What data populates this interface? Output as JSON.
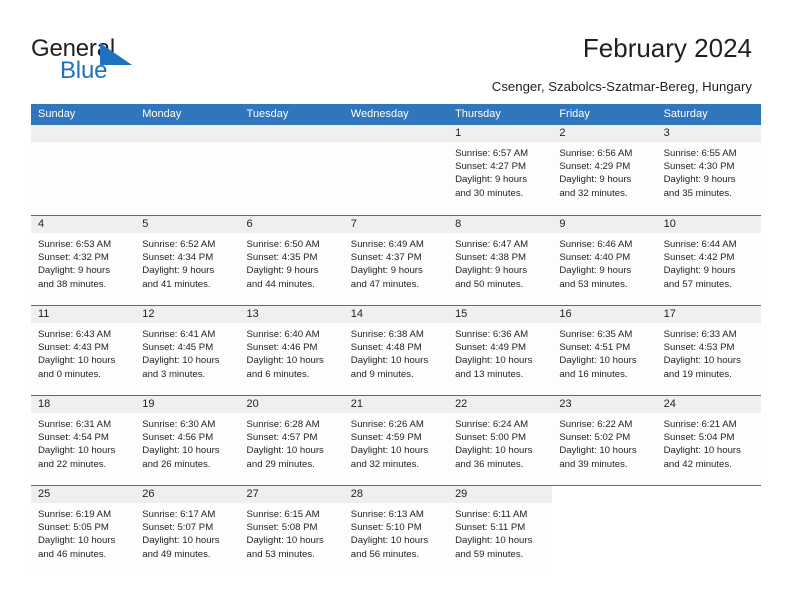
{
  "brand": {
    "name_part1": "General",
    "name_part2": "Blue",
    "mark": "triangle-logo"
  },
  "header": {
    "title": "February 2024",
    "subtitle": "Csenger, Szabolcs-Szatmar-Bereg, Hungary"
  },
  "calendar": {
    "weekdays": [
      "Sunday",
      "Monday",
      "Tuesday",
      "Wednesday",
      "Thursday",
      "Friday",
      "Saturday"
    ],
    "accent_color": "#2f76bc",
    "daynum_bg": "#efefef",
    "weeks": [
      [
        {
          "day": "",
          "lines": []
        },
        {
          "day": "",
          "lines": []
        },
        {
          "day": "",
          "lines": []
        },
        {
          "day": "",
          "lines": []
        },
        {
          "day": "1",
          "lines": [
            "Sunrise: 6:57 AM",
            "Sunset: 4:27 PM",
            "Daylight: 9 hours",
            "and 30 minutes."
          ]
        },
        {
          "day": "2",
          "lines": [
            "Sunrise: 6:56 AM",
            "Sunset: 4:29 PM",
            "Daylight: 9 hours",
            "and 32 minutes."
          ]
        },
        {
          "day": "3",
          "lines": [
            "Sunrise: 6:55 AM",
            "Sunset: 4:30 PM",
            "Daylight: 9 hours",
            "and 35 minutes."
          ]
        }
      ],
      [
        {
          "day": "4",
          "lines": [
            "Sunrise: 6:53 AM",
            "Sunset: 4:32 PM",
            "Daylight: 9 hours",
            "and 38 minutes."
          ]
        },
        {
          "day": "5",
          "lines": [
            "Sunrise: 6:52 AM",
            "Sunset: 4:34 PM",
            "Daylight: 9 hours",
            "and 41 minutes."
          ]
        },
        {
          "day": "6",
          "lines": [
            "Sunrise: 6:50 AM",
            "Sunset: 4:35 PM",
            "Daylight: 9 hours",
            "and 44 minutes."
          ]
        },
        {
          "day": "7",
          "lines": [
            "Sunrise: 6:49 AM",
            "Sunset: 4:37 PM",
            "Daylight: 9 hours",
            "and 47 minutes."
          ]
        },
        {
          "day": "8",
          "lines": [
            "Sunrise: 6:47 AM",
            "Sunset: 4:38 PM",
            "Daylight: 9 hours",
            "and 50 minutes."
          ]
        },
        {
          "day": "9",
          "lines": [
            "Sunrise: 6:46 AM",
            "Sunset: 4:40 PM",
            "Daylight: 9 hours",
            "and 53 minutes."
          ]
        },
        {
          "day": "10",
          "lines": [
            "Sunrise: 6:44 AM",
            "Sunset: 4:42 PM",
            "Daylight: 9 hours",
            "and 57 minutes."
          ]
        }
      ],
      [
        {
          "day": "11",
          "lines": [
            "Sunrise: 6:43 AM",
            "Sunset: 4:43 PM",
            "Daylight: 10 hours",
            "and 0 minutes."
          ]
        },
        {
          "day": "12",
          "lines": [
            "Sunrise: 6:41 AM",
            "Sunset: 4:45 PM",
            "Daylight: 10 hours",
            "and 3 minutes."
          ]
        },
        {
          "day": "13",
          "lines": [
            "Sunrise: 6:40 AM",
            "Sunset: 4:46 PM",
            "Daylight: 10 hours",
            "and 6 minutes."
          ]
        },
        {
          "day": "14",
          "lines": [
            "Sunrise: 6:38 AM",
            "Sunset: 4:48 PM",
            "Daylight: 10 hours",
            "and 9 minutes."
          ]
        },
        {
          "day": "15",
          "lines": [
            "Sunrise: 6:36 AM",
            "Sunset: 4:49 PM",
            "Daylight: 10 hours",
            "and 13 minutes."
          ]
        },
        {
          "day": "16",
          "lines": [
            "Sunrise: 6:35 AM",
            "Sunset: 4:51 PM",
            "Daylight: 10 hours",
            "and 16 minutes."
          ]
        },
        {
          "day": "17",
          "lines": [
            "Sunrise: 6:33 AM",
            "Sunset: 4:53 PM",
            "Daylight: 10 hours",
            "and 19 minutes."
          ]
        }
      ],
      [
        {
          "day": "18",
          "lines": [
            "Sunrise: 6:31 AM",
            "Sunset: 4:54 PM",
            "Daylight: 10 hours",
            "and 22 minutes."
          ]
        },
        {
          "day": "19",
          "lines": [
            "Sunrise: 6:30 AM",
            "Sunset: 4:56 PM",
            "Daylight: 10 hours",
            "and 26 minutes."
          ]
        },
        {
          "day": "20",
          "lines": [
            "Sunrise: 6:28 AM",
            "Sunset: 4:57 PM",
            "Daylight: 10 hours",
            "and 29 minutes."
          ]
        },
        {
          "day": "21",
          "lines": [
            "Sunrise: 6:26 AM",
            "Sunset: 4:59 PM",
            "Daylight: 10 hours",
            "and 32 minutes."
          ]
        },
        {
          "day": "22",
          "lines": [
            "Sunrise: 6:24 AM",
            "Sunset: 5:00 PM",
            "Daylight: 10 hours",
            "and 36 minutes."
          ]
        },
        {
          "day": "23",
          "lines": [
            "Sunrise: 6:22 AM",
            "Sunset: 5:02 PM",
            "Daylight: 10 hours",
            "and 39 minutes."
          ]
        },
        {
          "day": "24",
          "lines": [
            "Sunrise: 6:21 AM",
            "Sunset: 5:04 PM",
            "Daylight: 10 hours",
            "and 42 minutes."
          ]
        }
      ],
      [
        {
          "day": "25",
          "lines": [
            "Sunrise: 6:19 AM",
            "Sunset: 5:05 PM",
            "Daylight: 10 hours",
            "and 46 minutes."
          ]
        },
        {
          "day": "26",
          "lines": [
            "Sunrise: 6:17 AM",
            "Sunset: 5:07 PM",
            "Daylight: 10 hours",
            "and 49 minutes."
          ]
        },
        {
          "day": "27",
          "lines": [
            "Sunrise: 6:15 AM",
            "Sunset: 5:08 PM",
            "Daylight: 10 hours",
            "and 53 minutes."
          ]
        },
        {
          "day": "28",
          "lines": [
            "Sunrise: 6:13 AM",
            "Sunset: 5:10 PM",
            "Daylight: 10 hours",
            "and 56 minutes."
          ]
        },
        {
          "day": "29",
          "lines": [
            "Sunrise: 6:11 AM",
            "Sunset: 5:11 PM",
            "Daylight: 10 hours",
            "and 59 minutes."
          ]
        },
        {
          "day": "",
          "lines": []
        },
        {
          "day": "",
          "lines": []
        }
      ]
    ]
  }
}
